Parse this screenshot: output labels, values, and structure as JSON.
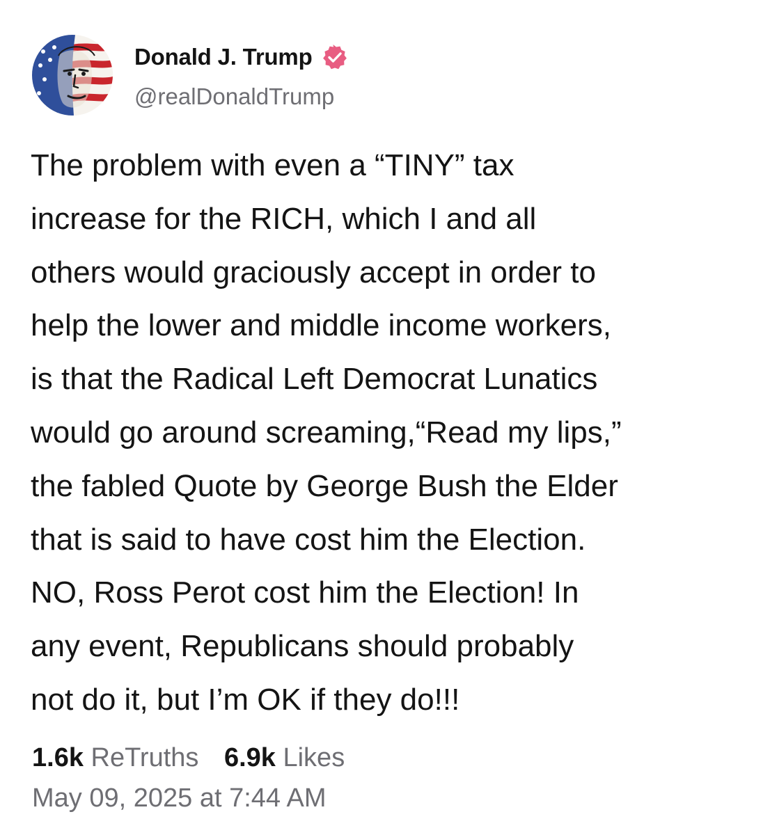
{
  "author": {
    "display_name": "Donald J. Trump",
    "handle": "@realDonaldTrump",
    "verified_icon": "verified-badge-icon",
    "verified_color": "#e85d82",
    "avatar_icon": "profile-portrait-flag-icon"
  },
  "post": {
    "lines": [
      "The problem with even a “TINY” tax",
      "increase for the RICH, which I and all",
      "others would graciously accept in order to",
      "help the lower and middle income workers,",
      "is that the Radical Left Democrat Lunatics",
      "would go around screaming,“Read my lips,”",
      "the fabled Quote by George Bush the Elder",
      "that is said to have cost him the Election.",
      "NO, Ross Perot cost him the Election! In",
      "any event, Republicans should probably",
      "not do it, but I’m OK if they do!!!"
    ]
  },
  "stats": {
    "retruths_count": "1.6k",
    "retruths_label": "ReTruths",
    "likes_count": "6.9k",
    "likes_label": "Likes"
  },
  "timestamp": "May 09, 2025 at 7:44 AM"
}
